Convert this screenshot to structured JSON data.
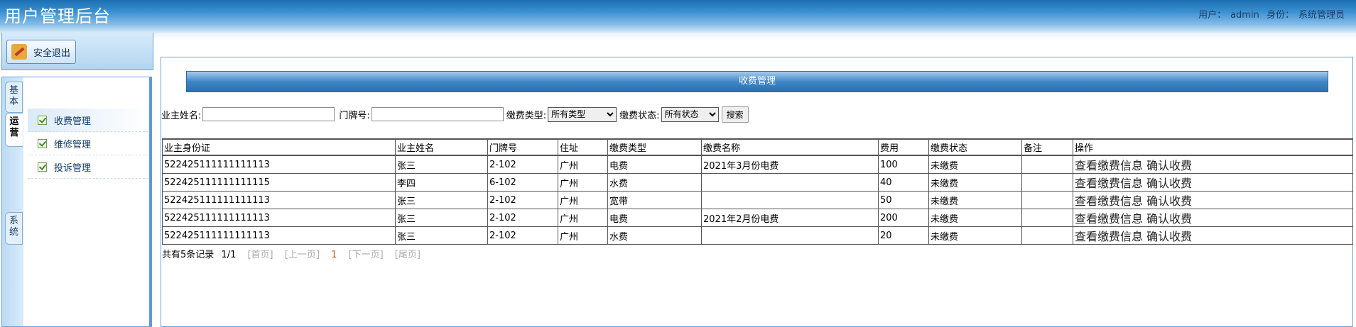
{
  "header": {
    "app_title": "用户管理后台",
    "user_label": "用户：",
    "user_name": "admin",
    "role_label": "身份：",
    "role_name": "系统管理员"
  },
  "sidebar": {
    "logout_label": "安全退出",
    "tabs": [
      {
        "label": "基本",
        "active": false
      },
      {
        "label": "运营",
        "active": true
      },
      {
        "label": "系统",
        "active": false
      }
    ],
    "items": [
      {
        "label": "收费管理",
        "active": true
      },
      {
        "label": "维修管理",
        "active": false
      },
      {
        "label": "投诉管理",
        "active": false
      }
    ]
  },
  "main": {
    "panel_title": "收费管理",
    "search": {
      "owner_name_label": "业主姓名:",
      "owner_name_value": "",
      "door_label": "门牌号:",
      "door_value": "",
      "fee_type_label": "缴费类型:",
      "fee_type_selected": "所有类型",
      "status_label": "缴费状态:",
      "status_selected": "所有状态",
      "search_button": "搜索"
    },
    "table": {
      "headers": [
        "业主身份证",
        "业主姓名",
        "门牌号",
        "住址",
        "缴费类型",
        "缴费名称",
        "费用",
        "缴费状态",
        "备注",
        "操作"
      ],
      "rows": [
        {
          "id_card": "522425111111111113",
          "name": "张三",
          "door": "2-102",
          "address": "广州",
          "fee_type": "电费",
          "fee_name": "2021年3月份电费",
          "amount": "100",
          "status": "未缴费",
          "remark": "",
          "op_view": "查看缴费信息",
          "op_confirm": "确认收费"
        },
        {
          "id_card": "522425111111111115",
          "name": "李四",
          "door": "6-102",
          "address": "广州",
          "fee_type": "水费",
          "fee_name": "",
          "amount": "40",
          "status": "未缴费",
          "remark": "",
          "op_view": "查看缴费信息",
          "op_confirm": "确认收费"
        },
        {
          "id_card": "522425111111111113",
          "name": "张三",
          "door": "2-102",
          "address": "广州",
          "fee_type": "宽带",
          "fee_name": "",
          "amount": "50",
          "status": "未缴费",
          "remark": "",
          "op_view": "查看缴费信息",
          "op_confirm": "确认收费"
        },
        {
          "id_card": "522425111111111113",
          "name": "张三",
          "door": "2-102",
          "address": "广州",
          "fee_type": "电费",
          "fee_name": "2021年2月份电费",
          "amount": "200",
          "status": "未缴费",
          "remark": "",
          "op_view": "查看缴费信息",
          "op_confirm": "确认收费"
        },
        {
          "id_card": "522425111111111113",
          "name": "张三",
          "door": "2-102",
          "address": "广州",
          "fee_type": "水费",
          "fee_name": "",
          "amount": "20",
          "status": "未缴费",
          "remark": "",
          "op_view": "查看缴费信息",
          "op_confirm": "确认收费"
        }
      ]
    },
    "pager": {
      "total_text": "共有5条记录",
      "page_text": "1/1",
      "first": "[首页]",
      "prev": "[上一页]",
      "current": "1",
      "next": "[下一页]",
      "last": "[尾页]"
    }
  },
  "colors": {
    "header_blue": "#1d6fb3",
    "panel_blue": "#3f87c7",
    "pager_current": "#d9541a"
  }
}
